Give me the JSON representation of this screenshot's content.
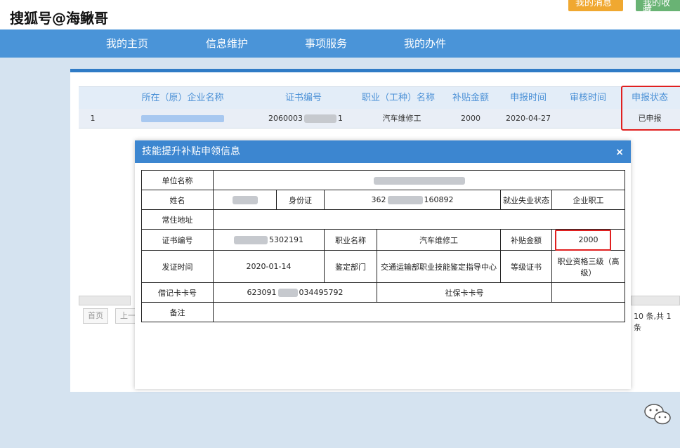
{
  "watermark": "搜狐号@海鳅哥",
  "top_buttons": {
    "messages": "我的消息",
    "favorites": "我的收藏"
  },
  "nav": [
    "我的主页",
    "信息维护",
    "事项服务",
    "我的办件"
  ],
  "grid": {
    "headers": [
      "所在（原）企业名称",
      "证书编号",
      "职业（工种）名称",
      "补贴金额",
      "申报时间",
      "审核时间",
      "申报状态"
    ],
    "row": {
      "index": "1",
      "cert_prefix": "2060003",
      "cert_suffix": "1",
      "occupation": "汽车维修工",
      "amount": "2000",
      "apply_time": "2020-04-27",
      "review_time": "",
      "status": "已申报"
    }
  },
  "pager": {
    "first": "首页",
    "prev": "上一",
    "info": "10 条,共 1 条"
  },
  "modal": {
    "title": "技能提升补贴申领信息",
    "close": "×",
    "labels": {
      "unit_name": "单位名称",
      "name": "姓名",
      "id_card": "身份证",
      "employment_status": "就业失业状态",
      "address": "常住地址",
      "cert_no": "证书编号",
      "job_name": "职业名称",
      "subsidy_amount": "补贴金额",
      "issue_date": "发证时间",
      "appraisal_dept": "鉴定部门",
      "grade_cert": "等级证书",
      "debit_card": "借记卡卡号",
      "social_card": "社保卡卡号",
      "remarks": "备注"
    },
    "values": {
      "id_prefix": "362",
      "id_suffix": "160892",
      "employment_status": "企业职工",
      "cert_suffix": "5302191",
      "job_name": "汽车维修工",
      "subsidy_amount": "2000",
      "issue_date": "2020-01-14",
      "appraisal_dept": "交通运输部职业技能鉴定指导中心",
      "grade_cert": "职业资格三级（高级）",
      "card_prefix": "623091",
      "card_suffix": "034495792"
    }
  },
  "colors": {
    "nav": "#4a94d8",
    "panel_border": "#2f7bc6",
    "modal_header": "#3c86d0",
    "highlight": "#e02020"
  }
}
